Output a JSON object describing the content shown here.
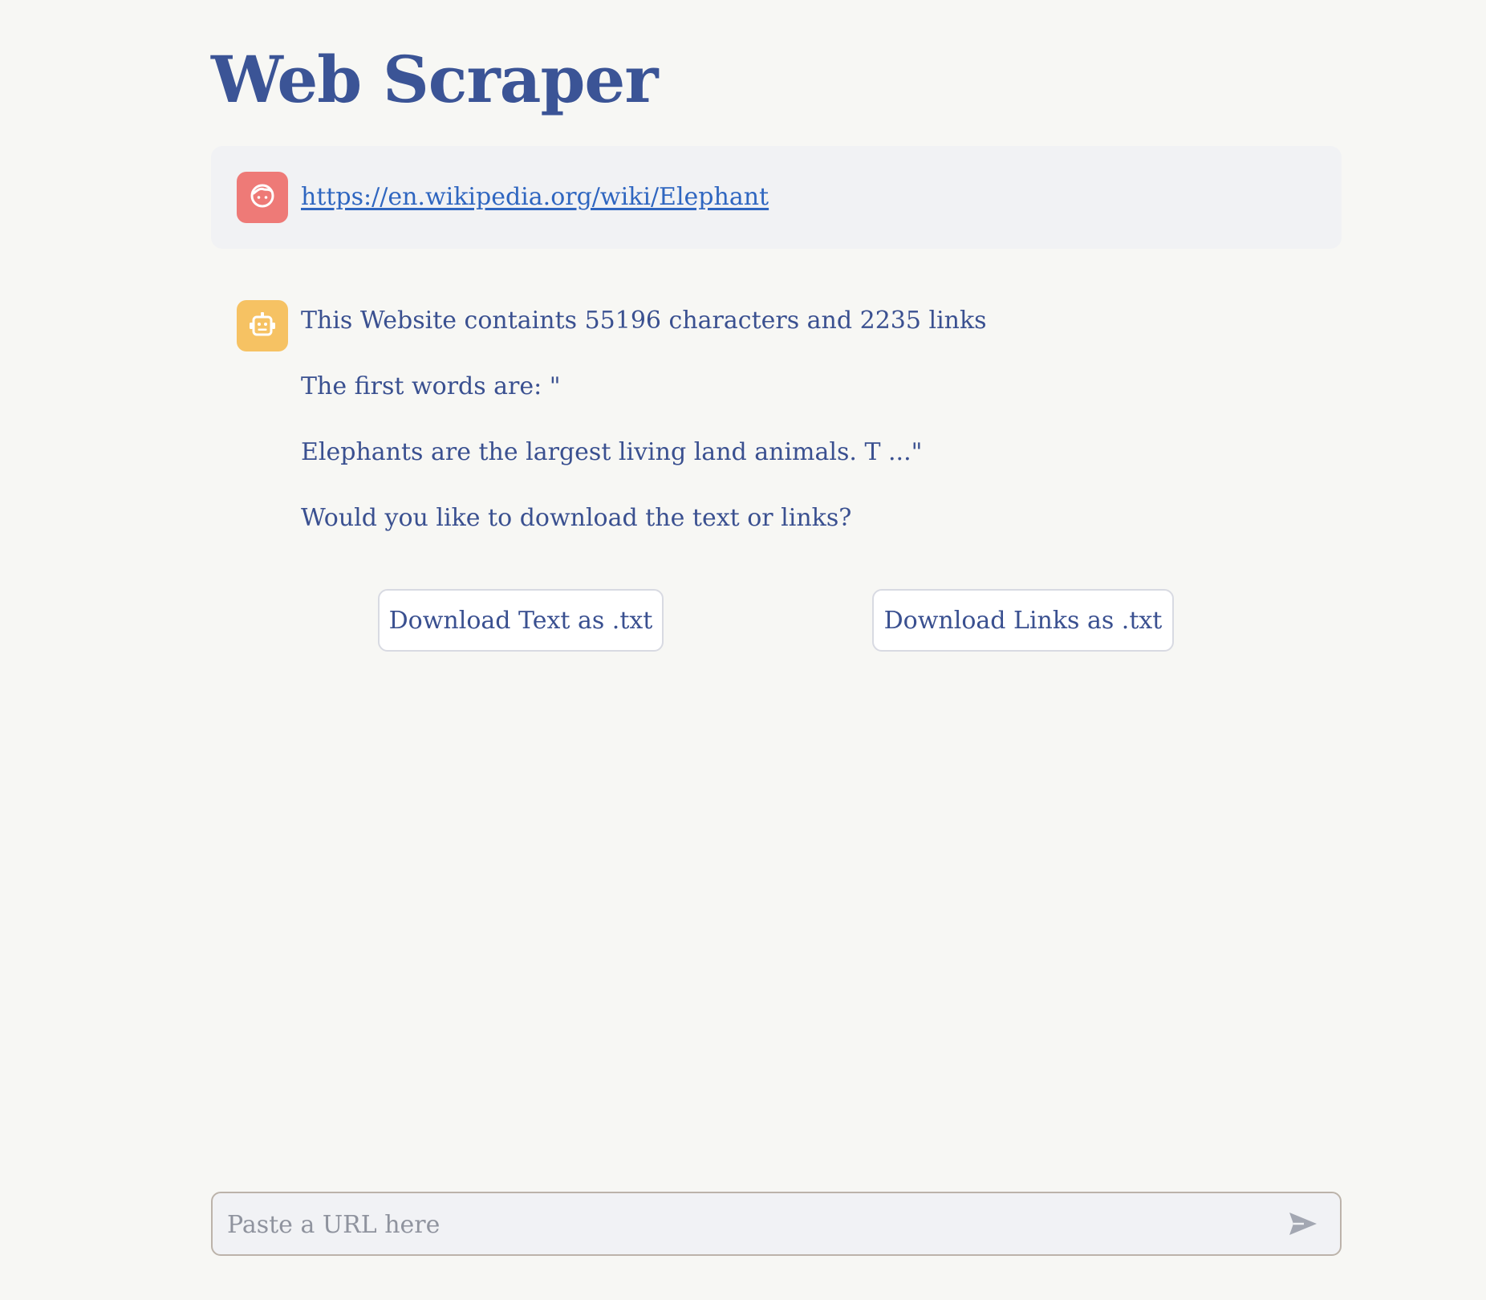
{
  "page": {
    "title": "Web Scraper"
  },
  "user_message": {
    "avatar_icon": "user-face-icon",
    "avatar_color": "#ee7a77",
    "link_text": "https://en.wikipedia.org/wiki/Elephant"
  },
  "bot_message": {
    "avatar_icon": "robot-icon",
    "avatar_color": "#f6c263",
    "lines": [
      "This Website containts 55196 characters and 2235 links",
      "The first words are: \"",
      "Elephants are the largest living land animals. T ...\"",
      "Would you like to download the text or links?"
    ]
  },
  "buttons": {
    "download_text": "Download Text as .txt",
    "download_links": "Download Links as .txt"
  },
  "chat_input": {
    "placeholder": "Paste a URL here",
    "value": "",
    "send_icon": "send-icon"
  },
  "colors": {
    "background": "#f7f7f4",
    "title": "#3b5496",
    "text": "#3a5090",
    "link": "#2f66c0"
  }
}
